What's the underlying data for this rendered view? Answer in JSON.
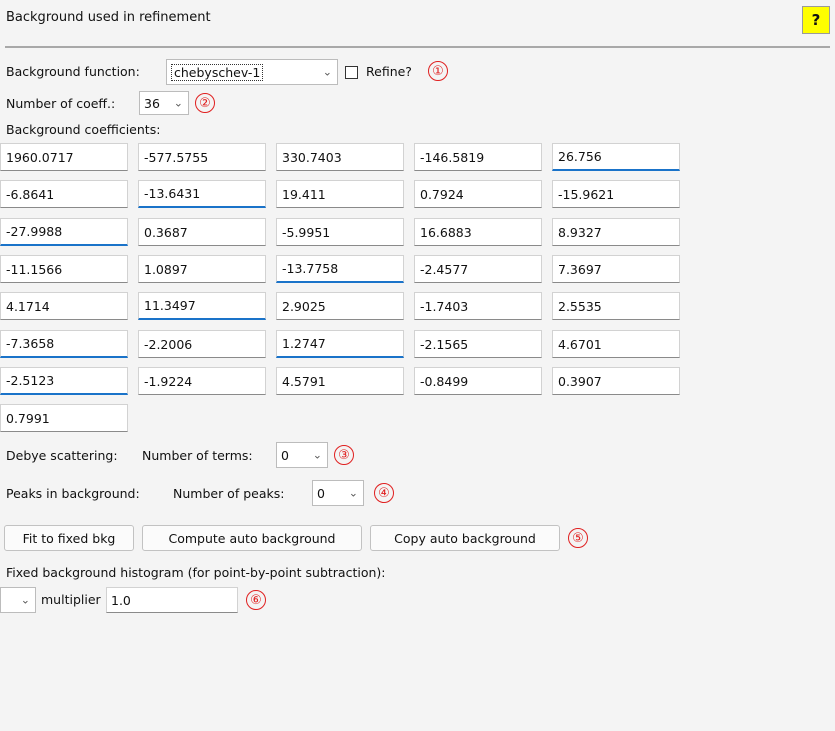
{
  "header": {
    "title": "Background used in refinement",
    "help_label": "?"
  },
  "background_function": {
    "label": "Background function:",
    "value": "chebyschev-1",
    "refine_label": "Refine?",
    "refine_checked": false,
    "badge": "①"
  },
  "num_coeff": {
    "label": "Number of coeff.:",
    "value": "36",
    "badge": "②"
  },
  "coefficients": {
    "label": "Background coefficients:",
    "values": [
      "1960.0717",
      "-577.5755",
      "330.7403",
      "-146.5819",
      "26.756",
      "-6.8641",
      "-13.6431",
      "19.411",
      "0.7924",
      "-15.9621",
      "-27.9988",
      "0.3687",
      "-5.9951",
      "16.6883",
      "8.9327",
      "-11.1566",
      "1.0897",
      "-13.7758",
      "-2.4577",
      "7.3697",
      "4.1714",
      "11.3497",
      "2.9025",
      "-1.7403",
      "2.5535",
      "-7.3658",
      "-2.2006",
      "1.2747",
      "-2.1565",
      "4.6701",
      "-2.5123",
      "-1.9224",
      "4.5791",
      "-0.8499",
      "0.3907",
      "0.7991"
    ]
  },
  "debye": {
    "label": "Debye scattering:",
    "terms_label": "Number of terms:",
    "value": "0",
    "badge": "③"
  },
  "peaks": {
    "label": "Peaks in background:",
    "num_label": "Number of peaks:",
    "value": "0",
    "badge": "④"
  },
  "buttons": {
    "fit": "Fit to fixed bkg",
    "compute": "Compute auto background",
    "copy": "Copy auto background",
    "badge": "⑤"
  },
  "fixed_bkg": {
    "label": "Fixed background histogram (for point-by-point subtraction):",
    "multiplier_label": "multiplier",
    "multiplier_value": "1.0",
    "badge": "⑥"
  }
}
